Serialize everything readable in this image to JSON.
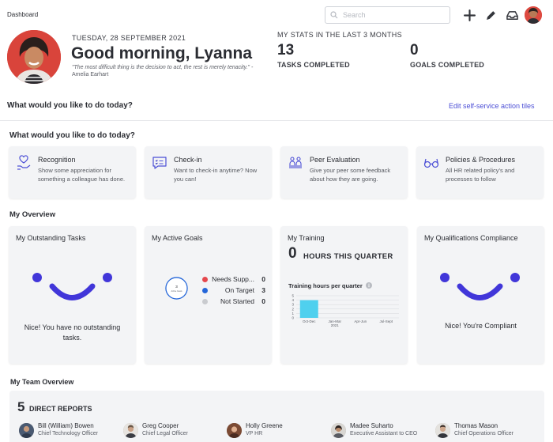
{
  "breadcrumb": "Dashboard",
  "search": {
    "placeholder": "Search"
  },
  "toolbar": {
    "icons": [
      "add-icon",
      "edit-pencil-icon",
      "inbox-icon"
    ]
  },
  "header": {
    "date": "TUESDAY, 28 SEPTEMBER 2021",
    "greeting": "Good morning, Lyanna",
    "quote": "\"The most difficult thing is the decision to act, the rest is merely tenacity.\" -",
    "quote_author": "Amelia Earhart"
  },
  "stats": {
    "title": "MY STATS IN THE LAST 3 MONTHS",
    "items": [
      {
        "value": "13",
        "label": "TASKS COMPLETED"
      },
      {
        "value": "0",
        "label": "GOALS COMPLETED"
      }
    ]
  },
  "actions": {
    "heading_top": "What would you like to do today?",
    "edit_link": "Edit self-service action tiles",
    "heading": "What would you like to do today?",
    "tiles": [
      {
        "title": "Recognition",
        "desc": "Show some appreciation for something a colleague has done.",
        "icon": "hand-heart-icon"
      },
      {
        "title": "Check-in",
        "desc": "Want to check-in anytime? Now you can!",
        "icon": "chat-checklist-icon"
      },
      {
        "title": "Peer Evaluation",
        "desc": "Give your peer some feedback about how they are going.",
        "icon": "people-icon"
      },
      {
        "title": "Policies & Procedures",
        "desc": "All HR related policy's and processes to follow",
        "icon": "glasses-icon"
      }
    ]
  },
  "overview": {
    "title": "My Overview",
    "tasks": {
      "title": "My Outstanding Tasks",
      "message": "Nice! You have no outstanding tasks."
    },
    "goals": {
      "title": "My Active Goals",
      "ring_value": "3",
      "ring_label": "Active Goals",
      "rows": [
        {
          "label": "Needs Supp...",
          "value": "0",
          "color": "#e5484d"
        },
        {
          "label": "On Target",
          "value": "3",
          "color": "#2466d9"
        },
        {
          "label": "Not Started",
          "value": "0",
          "color": "#c9cbcf"
        }
      ]
    },
    "training": {
      "title": "My Training",
      "hours": "0",
      "hours_label": "HOURS THIS QUARTER",
      "chart_title": "Training hours per quarter"
    },
    "compliance": {
      "title": "My Qualifications Compliance",
      "message": "Nice! You're Compliant"
    }
  },
  "chart_data": {
    "type": "bar",
    "title": "Training hours per quarter",
    "categories": [
      "Oct-Dec",
      "Jan-Mar 2021",
      "Apr-Jun",
      "Jul-Sept"
    ],
    "category_lines": [
      [
        "Oct-Dec"
      ],
      [
        "Jan-Mar",
        "2021"
      ],
      [
        "Apr-Jun"
      ],
      [
        "Jul-Sept"
      ]
    ],
    "values": [
      4,
      0,
      0,
      0
    ],
    "ylim": [
      0,
      5
    ],
    "yticks": [
      "0",
      "1",
      "2",
      "3",
      "4",
      "5"
    ],
    "color": "#4fd0ee",
    "grid": true
  },
  "team": {
    "title": "My Team Overview",
    "count": "5",
    "count_label": "DIRECT REPORTS",
    "members": [
      {
        "name": "Bill (William) Bowen",
        "role": "Chief Technology Officer"
      },
      {
        "name": "Greg Cooper",
        "role": "Chief Legal Officer"
      },
      {
        "name": "Holly Greene",
        "role": "VP HR"
      },
      {
        "name": "Madee Suharto",
        "role": "Executive Assistant to CEO"
      },
      {
        "name": "Thomas Mason",
        "role": "Chief Operations Officer"
      }
    ]
  },
  "colors": {
    "accent": "#4c4fd6",
    "smile": "#4136d9",
    "bar": "#4fd0ee",
    "card": "#f3f4f6"
  }
}
